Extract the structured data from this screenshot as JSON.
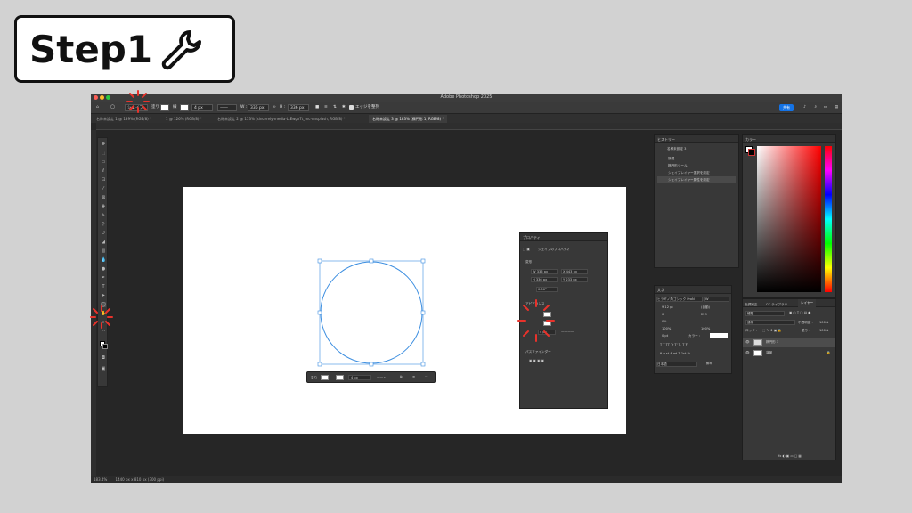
{
  "step_label": "Step1",
  "app": {
    "title": "Adobe Photoshop 2025",
    "options": {
      "mode": "シェイプ",
      "fill_label": "塗り",
      "stroke_label": "線",
      "stroke_width": "4 px",
      "w_label": "W :",
      "w_value": "336 px",
      "h_label": "H :",
      "h_value": "336 px",
      "align_edges": "エッジを整列",
      "share": "共有"
    },
    "tabs": [
      "名称未設定 1 @ 139% (RGB/8) *",
      "1 @ 126% (RGB/8) *",
      "名称未設定 2 @ 153% (sincerely-media-LtEwgx7t_mc-unsplash, RGB/8) *",
      "名称未設定 3 @ 183% (楕円形 1, RGB/8) *"
    ],
    "status": {
      "zoom": "183.4%",
      "doc_size": "1440 px x 810 px (300 ppi)"
    },
    "history": {
      "title": "ヒストリー",
      "doc": "名称未設定 3",
      "items": [
        "新規",
        "楕円形ツール",
        "シェイプレイヤー選択を設定",
        "シェイプレイヤー属性を設定"
      ]
    },
    "properties": {
      "title": "プロパティ",
      "subtitle": "シェイプのプロパティ",
      "transform_label": "変形",
      "w": "W 336 px",
      "x": "X 443 px",
      "h": "H 336 px",
      "y": "Y 233 px",
      "angle": "0.00°",
      "appearance_label": "アピアランス",
      "stroke_width": "4 px",
      "pathfinder_label": "パスファインダー"
    },
    "character": {
      "title": "文字",
      "font": "ヒラギノ角ゴシック ProN",
      "style": "W",
      "size": "9.12 pt",
      "leading": "(自動)",
      "kerning": "0",
      "tracking": "229",
      "tsume": "0%",
      "vscale": "100%",
      "hscale": "100%",
      "baseline": "0 pt",
      "color_label": "カラー :",
      "language": "日本語",
      "aa": "鮮明"
    },
    "color_panel": {
      "title": "カラー"
    },
    "layers": {
      "tabs": [
        "色調補正",
        "CC ライブラリ",
        "レイヤー"
      ],
      "kind": "種類",
      "blend": "通常",
      "opacity_label": "不透明度 :",
      "opacity": "100%",
      "lock_label": "ロック :",
      "fill_label": "塗り :",
      "fill": "100%",
      "items": [
        {
          "name": "楕円形 1"
        },
        {
          "name": "背景"
        }
      ]
    },
    "context_bar": {
      "fill_label": "塗り",
      "stroke_width": "4 px"
    }
  },
  "colors": {
    "accent": "#1473e6",
    "selection": "#3c8ee0",
    "burst": "#e8322b"
  }
}
